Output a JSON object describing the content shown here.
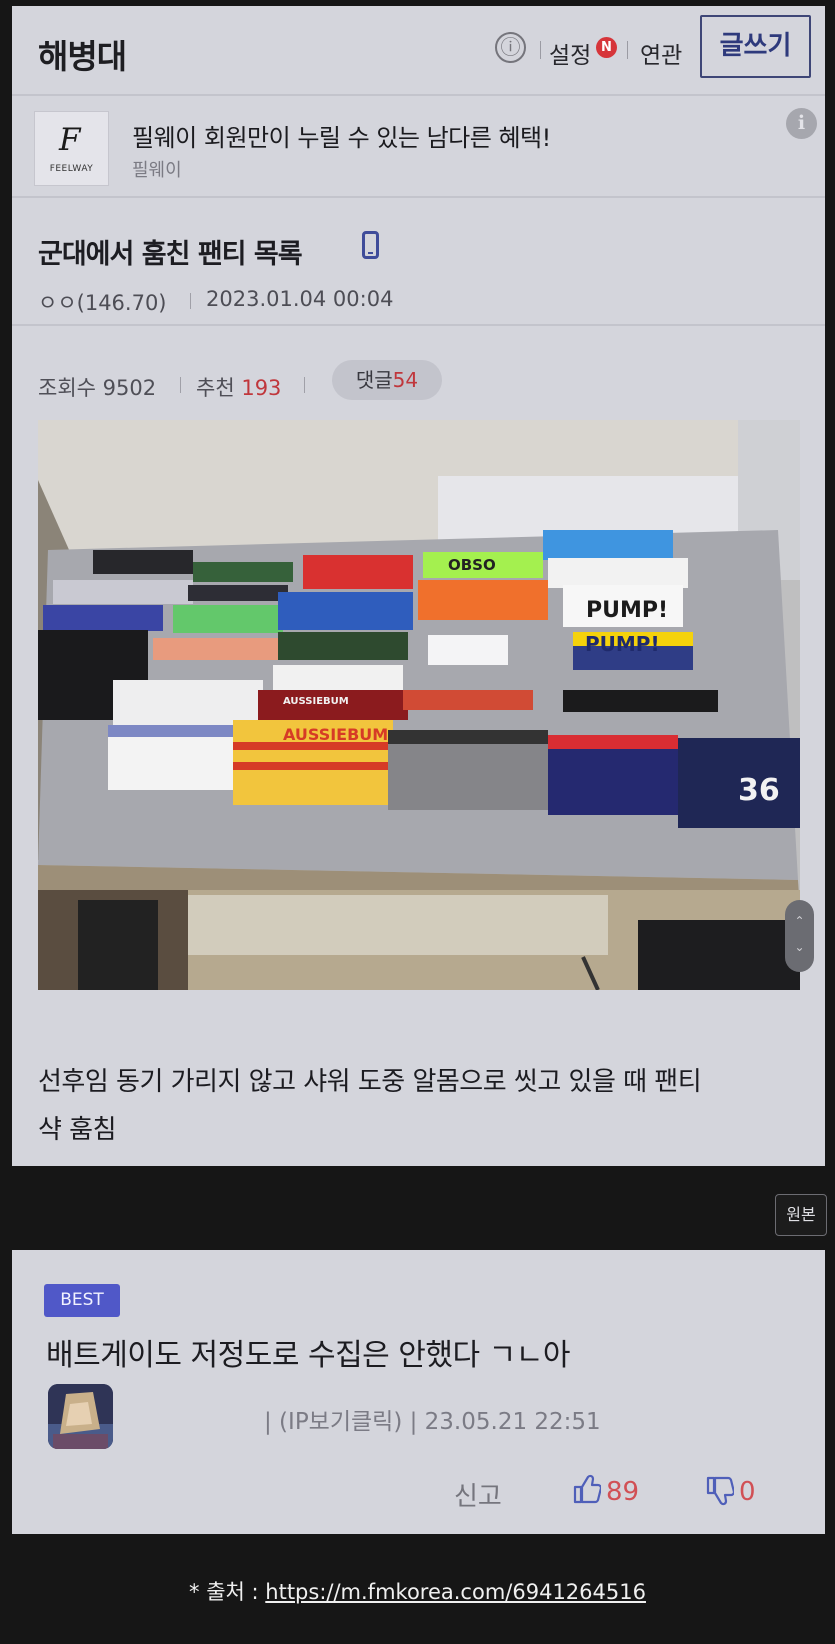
{
  "header": {
    "gallery_name": "해병대",
    "info_icon": "ⓘ",
    "settings_label": "설정",
    "new_badge": "N",
    "related_label": "연관",
    "write_button": "글쓰기"
  },
  "ad": {
    "logo_mark": "F",
    "logo_text": "FEELWAY",
    "title": "필웨이 회원만이 누릴 수 있는 남다른 혜택!",
    "advertiser": "필웨이",
    "info_icon": "i"
  },
  "post": {
    "title": "군대에서 훔친 팬티 목록",
    "author": "ㅇㅇ(146.70)",
    "date": "2023.01.04 00:04",
    "views_label": "조회수",
    "views": "9502",
    "recommend_label": "추천",
    "recommend": "193",
    "comments_label": "댓글",
    "comments": "54",
    "body_line1": "선후임 동기 가리지 않고 샤워 도중 알몸으로 씻고 있을 때 팬티",
    "body_line2": "샥 훔침",
    "image_label_1": "PUMP!",
    "image_label_2": "PUMP!",
    "image_label_3": "AUSSIEBUM",
    "image_label_4": "AUSSIEBUM",
    "image_label_5": "36",
    "image_label_6": "OBSO",
    "scroll_up": "⌃",
    "scroll_down": "⌄"
  },
  "original_button": "원본",
  "best_comment": {
    "badge": "BEST",
    "text": "배트게이도 저정도로 수집은 안했다 ㄱㄴ아",
    "meta": "| (IP보기클릭) | 23.05.21 22:51",
    "report_label": "신고",
    "likes": "89",
    "dislikes": "0"
  },
  "source": {
    "prefix": "* 출처 : ",
    "url": "https://m.fmkorea.com/6941264516"
  },
  "colors": {
    "card_bg": "#d4d5dc",
    "page_bg": "#161616",
    "accent_red": "#c0373c",
    "badge_blue": "#5058c8"
  }
}
